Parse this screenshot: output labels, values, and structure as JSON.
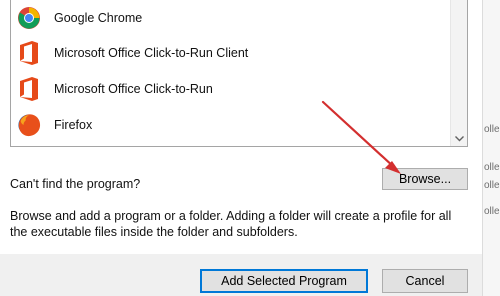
{
  "programs": [
    {
      "label": "Google Chrome",
      "icon": "chrome-icon"
    },
    {
      "label": "Microsoft Office Click-to-Run Client",
      "icon": "office-icon"
    },
    {
      "label": "Microsoft Office Click-to-Run",
      "icon": "office-icon"
    },
    {
      "label": "Firefox",
      "icon": "firefox-icon"
    }
  ],
  "cant_find_label": "Can't find the program?",
  "browse_label": "Browse...",
  "description": "Browse and add a program or a folder. Adding a folder will create a profile for all the executable files inside the folder and subfolders.",
  "add_selected_label": "Add Selected Program",
  "cancel_label": "Cancel",
  "right_strip_fragments": [
    "olled",
    "olled",
    "olled",
    "olled"
  ],
  "colors": {
    "accent": "#0078d7",
    "office": "#e64a19",
    "arrow": "#d32f2f"
  }
}
